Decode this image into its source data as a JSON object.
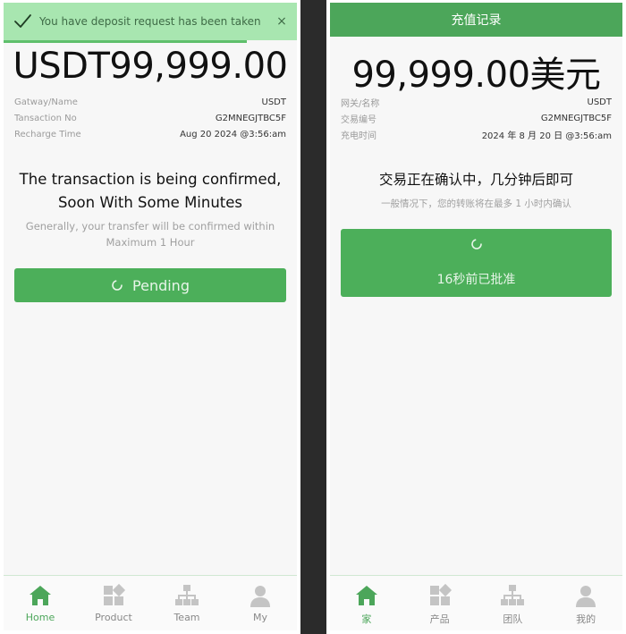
{
  "left": {
    "toast": {
      "message": "You have deposit request has been taken",
      "close": "×"
    },
    "amount": "USDT99,999.00",
    "details": [
      {
        "label": "Gatway/Name",
        "value": "USDT"
      },
      {
        "label": "Tansaction No",
        "value": "G2MNEGJTBC5F"
      },
      {
        "label": "Recharge Time",
        "value": "Aug 20 2024 @3:56:am"
      }
    ],
    "status_title": "The transaction is being confirmed, Soon With Some Minutes",
    "status_subtitle": "Generally, your transfer will be confirmed within Maximum 1 Hour",
    "button_label": "Pending",
    "tabs": [
      {
        "label": "Home",
        "icon": "home-icon",
        "active": true
      },
      {
        "label": "Product",
        "icon": "product-grid-icon",
        "active": false
      },
      {
        "label": "Team",
        "icon": "team-org-icon",
        "active": false
      },
      {
        "label": "My",
        "icon": "user-icon",
        "active": false
      }
    ]
  },
  "right": {
    "header_title": "充值记录",
    "amount": "99,999.00美元",
    "details": [
      {
        "label": "网关/名称",
        "value": "USDT"
      },
      {
        "label": "交易编号",
        "value": "G2MNEGJTBC5F"
      },
      {
        "label": "充电时间",
        "value": "2024 年 8 月 20 日 @3:56:am"
      }
    ],
    "status_title": "交易正在确认中，几分钟后即可",
    "status_subtitle": "一般情况下，您的转账将在最多 1 小时内确认",
    "button_label": "16秒前已批准",
    "tabs": [
      {
        "label": "家",
        "icon": "home-icon",
        "active": true
      },
      {
        "label": "产品",
        "icon": "product-grid-icon",
        "active": false
      },
      {
        "label": "团队",
        "icon": "team-org-icon",
        "active": false
      },
      {
        "label": "我的",
        "icon": "user-icon",
        "active": false
      }
    ]
  },
  "colors": {
    "accent": "#4ca65a",
    "button": "#4caf5a",
    "toast_bg": "#a8e6b0",
    "icon_inactive": "#c4c4c4"
  }
}
